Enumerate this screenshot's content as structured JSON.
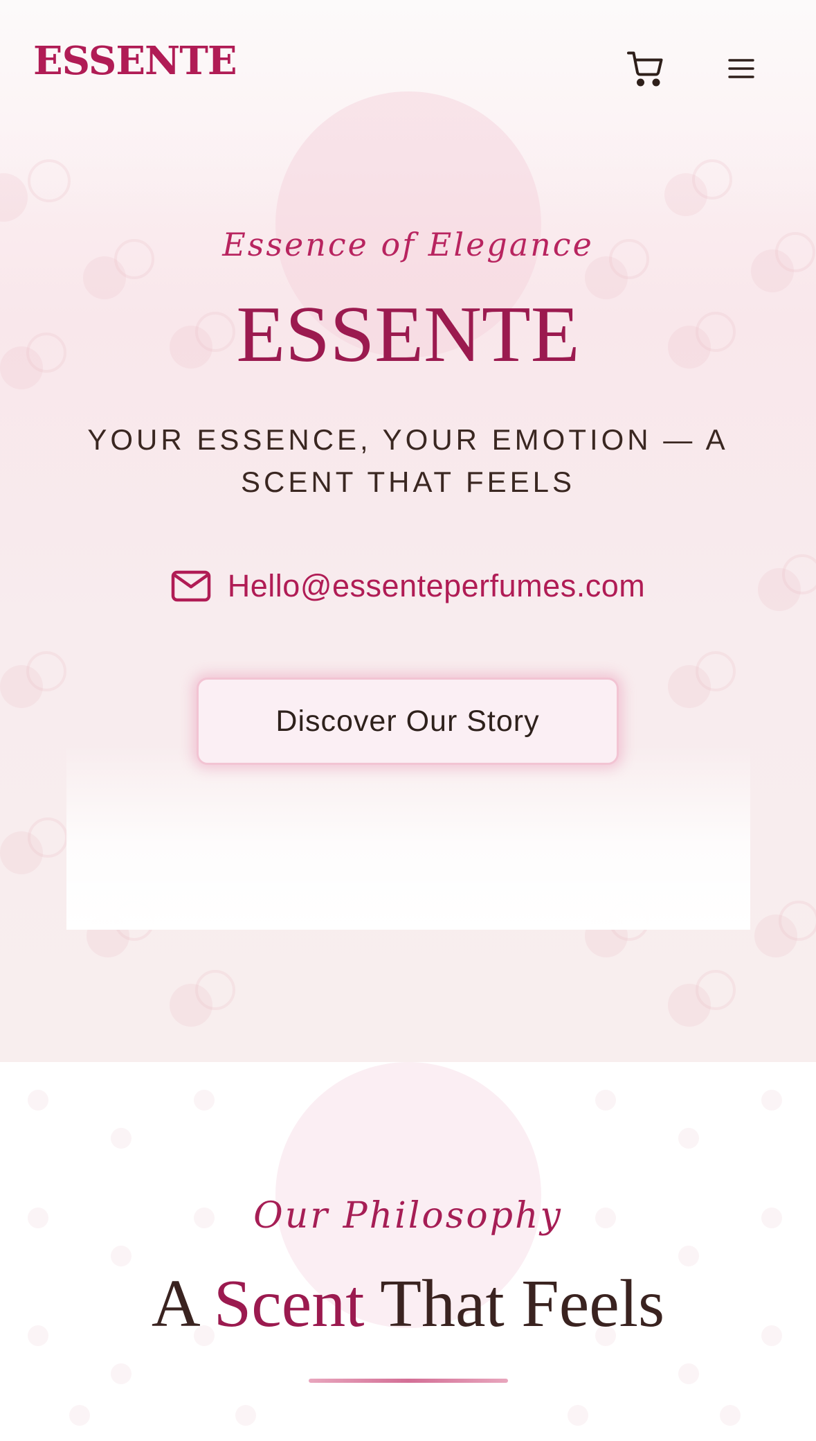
{
  "header": {
    "brand": "ESSENTE",
    "cart_icon": "cart-icon",
    "menu_icon": "hamburger-menu-icon"
  },
  "hero": {
    "tagline": "Essence of Elegance",
    "title": "ESSENTE",
    "subtitle": "YOUR ESSENCE, YOUR EMOTION — A SCENT THAT FEELS",
    "email_icon": "mail-icon",
    "email": "Hello@essenteperfumes.com",
    "cta_label": "Discover Our Story"
  },
  "philosophy": {
    "eyebrow": "Our Philosophy",
    "heading_before": "A ",
    "heading_accent": "Scent",
    "heading_after": " That Feels"
  },
  "colors": {
    "brand": "#b01c55",
    "accent": "#9b1a4f",
    "text_dark": "#3a2320",
    "hero_bg": "#f9e7eb"
  }
}
